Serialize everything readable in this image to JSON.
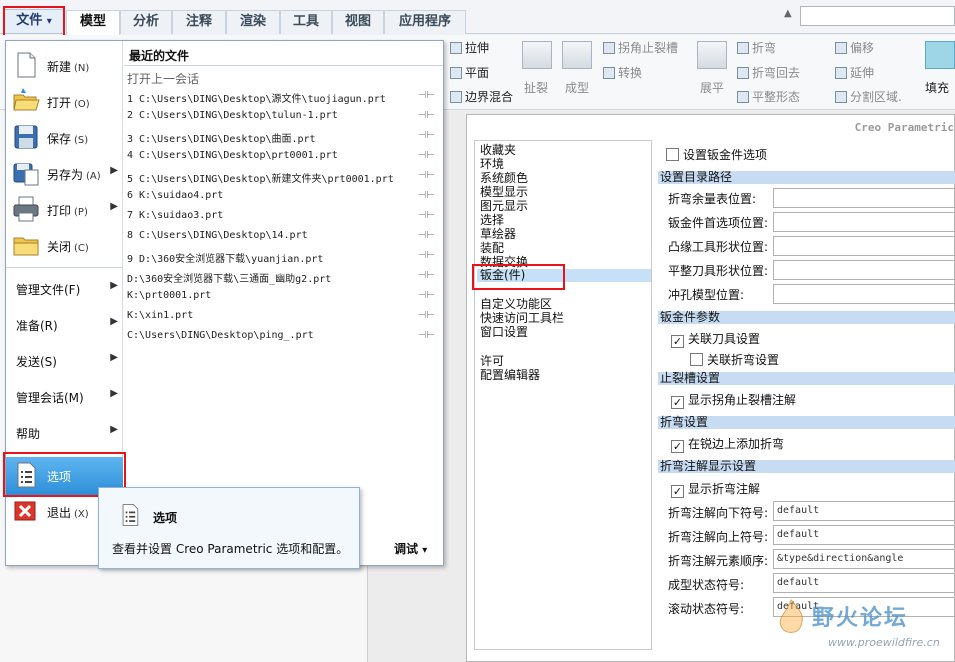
{
  "tabs": {
    "file": "文件",
    "file_arrow": "▾",
    "items": [
      "模型",
      "分析",
      "注释",
      "渲染",
      "工具",
      "视图",
      "应用程序"
    ]
  },
  "ribbon": {
    "pull": "拉伸",
    "plane": "平面",
    "boundary_blend": "边界混合",
    "rip": "扯裂",
    "form": "成型",
    "corner_relief": "拐角止裂槽",
    "convert": "转换",
    "unbend": "展平",
    "bend": "折弯",
    "bend_back": "折弯回去",
    "flatten_form": "平整形态",
    "offset": "偏移",
    "extend": "延伸",
    "split_area": "分割区域.",
    "fill": "填充"
  },
  "file_menu": {
    "new": {
      "label": "新建",
      "key": "(N)"
    },
    "open": {
      "label": "打开",
      "key": "(O)"
    },
    "save": {
      "label": "保存",
      "key": "(S)"
    },
    "save_as": {
      "label": "另存为",
      "key": "(A)"
    },
    "print": {
      "label": "打印",
      "key": "(P)"
    },
    "close": {
      "label": "关闭",
      "key": "(C)"
    },
    "manage_file": "管理文件(F)",
    "prepare": "准备(R)",
    "send": "发送(S)",
    "manage_session": "管理会话(M)",
    "help": "帮助",
    "options": "选项",
    "exit": {
      "label": "退出",
      "key": "(X)"
    },
    "recent_title": "最近的文件",
    "open_last": "打开上一会话",
    "recent_files": [
      "1 C:\\Users\\DING\\Desktop\\源文件\\tuojiagun.prt",
      "2 C:\\Users\\DING\\Desktop\\tulun-1.prt",
      "3 C:\\Users\\DING\\Desktop\\曲面.prt",
      "4 C:\\Users\\DING\\Desktop\\prt0001.prt",
      "5 C:\\Users\\DING\\Desktop\\新建文件夹\\prt0001.prt",
      "6 K:\\suidao4.prt",
      "7 K:\\suidao3.prt",
      "8 C:\\Users\\DING\\Desktop\\14.prt",
      "9 D:\\360安全浏览器下载\\yuanjian.prt",
      "D:\\360安全浏览器下载\\三通面_幽助g2.prt",
      "K:\\prt0001.prt",
      "K:\\xin1.prt",
      "C:\\Users\\DING\\Desktop\\ping_.prt"
    ],
    "debug": "调试",
    "debug_arrow": "▾"
  },
  "tooltip": {
    "title": "选项",
    "description": "查看并设置 Creo Parametric 选项和配置。"
  },
  "options_dialog": {
    "title": "Creo Parametric",
    "categories": [
      "收藏夹",
      "环境",
      "系统颜色",
      "模型显示",
      "图元显示",
      "选择",
      "草绘器",
      "装配",
      "数据交换",
      "钣金(件)",
      "自定义功能区",
      "快速访问工具栏",
      "窗口设置",
      "许可",
      "配置编辑器"
    ],
    "top_check": "设置钣金件选项",
    "section_paths": "设置目录路径",
    "fields_paths": [
      "折弯余量表位置:",
      "钣金件首选项位置:",
      "凸缘工具形状位置:",
      "平整刀具形状位置:",
      "冲孔模型位置:"
    ],
    "section_params": "钣金件参数",
    "check_link_tool": "关联刀具设置",
    "check_link_bend": "关联折弯设置",
    "section_relief": "止裂槽设置",
    "check_show_relief": "显示拐角止裂槽注解",
    "section_bend": "折弯设置",
    "check_add_bend": "在锐边上添加折弯",
    "section_note": "折弯注解显示设置",
    "check_show_note": "显示折弯注解",
    "note_fields": [
      {
        "label": "折弯注解向下符号:",
        "value": "default"
      },
      {
        "label": "折弯注解向上符号:",
        "value": "default"
      },
      {
        "label": "折弯注解元素顺序:",
        "value": "&type&direction&angle"
      },
      {
        "label": "成型状态符号:",
        "value": "default"
      },
      {
        "label": "滚动状态符号:",
        "value": "default"
      }
    ]
  },
  "watermark": {
    "title": "野火论坛",
    "url": "www.proewildfire.cn"
  },
  "colors": {
    "highlight_red": "#e8141b",
    "selection_blue": "#2d8fd8",
    "section_header": "#c7dcf3"
  }
}
